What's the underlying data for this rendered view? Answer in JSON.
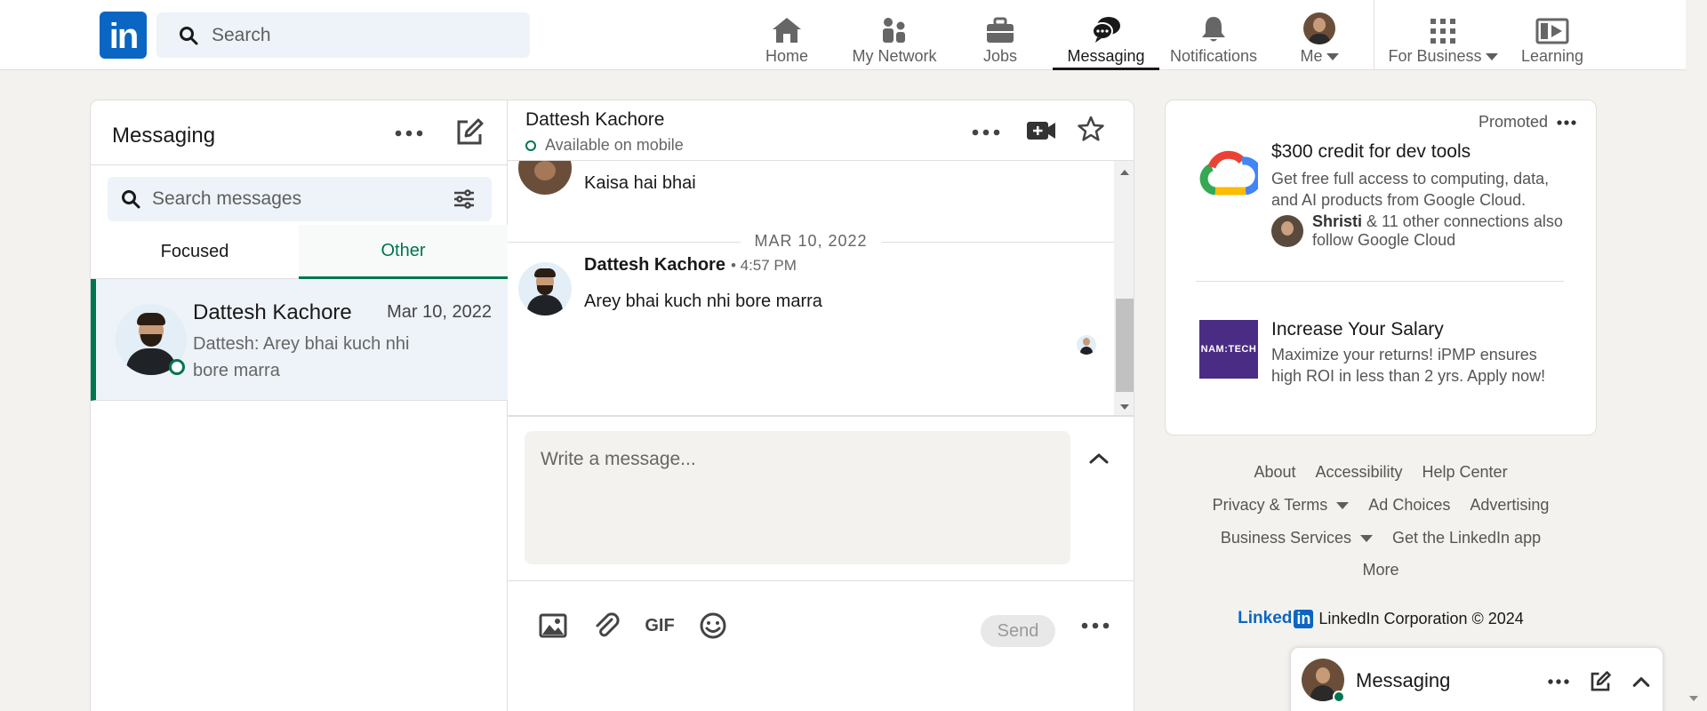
{
  "nav": {
    "search_placeholder": "Search",
    "items": [
      {
        "label": "Home",
        "icon": "home-icon"
      },
      {
        "label": "My Network",
        "icon": "network-icon"
      },
      {
        "label": "Jobs",
        "icon": "briefcase-icon"
      },
      {
        "label": "Messaging",
        "icon": "messaging-icon",
        "active": true
      },
      {
        "label": "Notifications",
        "icon": "bell-icon"
      },
      {
        "label": "Me",
        "icon": "avatar"
      },
      {
        "label": "For Business",
        "icon": "grid-icon"
      },
      {
        "label": "Learning",
        "icon": "learning-icon"
      }
    ],
    "logo_text": "in"
  },
  "messaging": {
    "title": "Messaging",
    "search_placeholder": "Search messages",
    "tabs": [
      "Focused",
      "Other"
    ],
    "active_tab": "Other",
    "conversation": {
      "name": "Dattesh Kachore",
      "date": "Mar 10, 2022",
      "snippet": "Dattesh: Arey bhai kuch nhi bore marra"
    }
  },
  "thread": {
    "name": "Dattesh Kachore",
    "status": "Available on mobile",
    "earlier_message": "Kaisa hai bhai",
    "date_separator": "MAR 10, 2022",
    "sender": "Dattesh Kachore",
    "time": "• 4:57 PM",
    "message": "Arey bhai kuch nhi bore marra",
    "compose_placeholder": "Write a message...",
    "gif_label": "GIF",
    "send_label": "Send"
  },
  "ads": {
    "promoted_label": "Promoted",
    "ad1": {
      "title": "$300 credit for dev tools",
      "desc": "Get free full access to computing, data, and AI products from Google Cloud.",
      "social_name": "Shristi",
      "social_rest": "& 11 other connections also follow Google Cloud"
    },
    "ad2": {
      "logo_text": "NAM:TECH",
      "title": "Increase Your Salary",
      "desc": "Maximize your returns! iPMP ensures high ROI in less than 2 yrs. Apply now!"
    }
  },
  "footer": {
    "row1": [
      "About",
      "Accessibility",
      "Help Center"
    ],
    "row2": [
      "Privacy & Terms",
      "Ad Choices",
      "Advertising"
    ],
    "row3": [
      "Business Services",
      "Get the LinkedIn app"
    ],
    "row4": [
      "More"
    ],
    "brand_text": "Linked",
    "brand_box": "in",
    "copyright": "LinkedIn Corporation © 2024"
  },
  "dock": {
    "title": "Messaging"
  },
  "colors": {
    "brand": "#0a66c2",
    "accent_green": "#01754f",
    "page_bg": "#f4f2ee"
  }
}
